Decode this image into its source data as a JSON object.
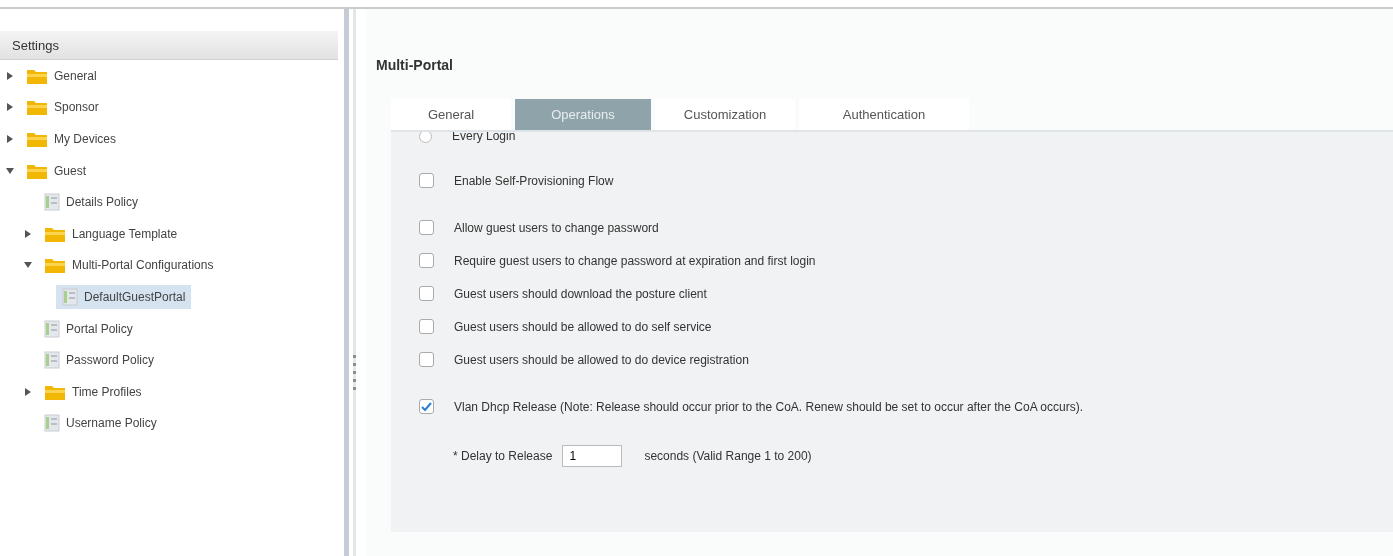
{
  "sidebar": {
    "title": "Settings",
    "tree": [
      {
        "label": "General",
        "kind": "folder",
        "expanded": false,
        "selected": false
      },
      {
        "label": "Sponsor",
        "kind": "folder",
        "expanded": false,
        "selected": false
      },
      {
        "label": "My Devices",
        "kind": "folder",
        "expanded": false,
        "selected": false
      },
      {
        "label": "Guest",
        "kind": "folder",
        "expanded": true,
        "selected": false,
        "children": [
          {
            "label": "Details Policy",
            "kind": "page",
            "selected": false
          },
          {
            "label": "Language Template",
            "kind": "folder",
            "expanded": false,
            "selected": false
          },
          {
            "label": "Multi-Portal Configurations",
            "kind": "folder",
            "expanded": true,
            "selected": false,
            "children": [
              {
                "label": "DefaultGuestPortal",
                "kind": "page",
                "selected": true
              }
            ]
          },
          {
            "label": "Portal Policy",
            "kind": "page",
            "selected": false
          },
          {
            "label": "Password Policy",
            "kind": "page",
            "selected": false
          },
          {
            "label": "Time Profiles",
            "kind": "folder",
            "expanded": false,
            "selected": false
          },
          {
            "label": "Username Policy",
            "kind": "page",
            "selected": false
          }
        ]
      }
    ]
  },
  "page": {
    "title": "Multi-Portal",
    "tabs": [
      {
        "label": "General",
        "selected": false
      },
      {
        "label": "Operations",
        "selected": true
      },
      {
        "label": "Customization",
        "selected": false
      },
      {
        "label": "Authentication",
        "selected": false
      }
    ],
    "sections": [
      [
        {
          "kind": "radio",
          "label": "Every Login",
          "selected": false
        }
      ],
      [
        {
          "kind": "checkbox",
          "label": "Enable Self-Provisioning Flow",
          "checked": false
        }
      ],
      [
        {
          "kind": "checkbox",
          "label": "Allow guest users to change password",
          "checked": false
        },
        {
          "kind": "checkbox",
          "label": "Require guest users to change password at expiration and first login",
          "checked": false
        },
        {
          "kind": "checkbox",
          "label": "Guest users should download the posture client",
          "checked": false
        },
        {
          "kind": "checkbox",
          "label": "Guest users should be allowed to do self service",
          "checked": false
        },
        {
          "kind": "checkbox",
          "label": "Guest users should be allowed to do device registration",
          "checked": false
        }
      ],
      [
        {
          "kind": "checkbox",
          "label": "Vlan Dhcp Release (Note: Release should occur prior to the CoA. Renew should be set to occur after the CoA occurs).",
          "checked": true
        },
        {
          "kind": "field",
          "label": "* Delay to Release",
          "value": "1",
          "hint": "seconds (Valid Range 1 to 200)"
        }
      ]
    ]
  }
}
